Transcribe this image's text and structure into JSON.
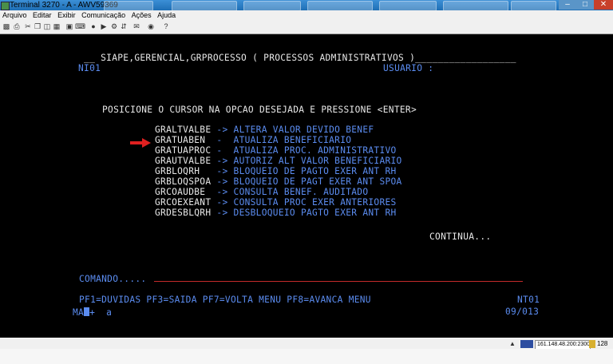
{
  "window": {
    "title": "Terminal 3270 - A - AWV59369"
  },
  "menu": {
    "arquivo": "Arquivo",
    "editar": "Editar",
    "exibir": "Exibir",
    "comunicacao": "Comunicação",
    "acoes": "Ações",
    "ajuda": "Ajuda"
  },
  "screen": {
    "header": " __ SIAPE,GERENCIAL,GRPROCESSO ( PROCESSOS ADMINISTRATIVOS )__________________",
    "terminal_id": "NI01",
    "usuario_label": "USUARIO :",
    "instruction": "POSICIONE O CURSOR NA OPCAO DESEJADA E PRESSIONE <ENTER>",
    "options": [
      {
        "code": "GRALTVALBE",
        "sep": "->",
        "desc": "ALTERA VALOR DEVIDO BENEF"
      },
      {
        "code": "GRATUABEN",
        "sep": "- ",
        "desc": "ATUALIZA BENEFICIARIO"
      },
      {
        "code": "GRATUAPROC",
        "sep": "- ",
        "desc": "ATUALIZA PROC. ADMINISTRATIVO"
      },
      {
        "code": "GRAUTVALBE",
        "sep": "->",
        "desc": "AUTORIZ ALT VALOR BENEFICIARIO"
      },
      {
        "code": "GRBLOQRH",
        "sep": "->",
        "desc": "BLOQUEIO DE PAGTO EXER ANT RH"
      },
      {
        "code": "GRBLOQSPOA",
        "sep": "->",
        "desc": "BLOQUEIO DE PAGT EXER ANT SPOA"
      },
      {
        "code": "GRCOAUDBE",
        "sep": "->",
        "desc": "CONSULTA BENEF. AUDITADO"
      },
      {
        "code": "GRCOEXEANT",
        "sep": "->",
        "desc": "CONSULTA PROC EXER ANTERIORES"
      },
      {
        "code": "GRDESBLQRH",
        "sep": "->",
        "desc": "DESBLOQUEIO PAGTO EXER ANT RH"
      }
    ],
    "continua": "CONTINUA...",
    "comando_label": "COMANDO.....",
    "pf_keys": "PF1=DUVIDAS PF3=SAIDA PF7=VOLTA MENU PF8=AVANCA MENU",
    "screen_code": "NT01",
    "oia_left_a": "MA",
    "oia_left_b": "+  a",
    "oia_right": "09/013"
  },
  "status": {
    "host": "161.148.48.200:23000",
    "count": "128"
  },
  "colors": {
    "terminal_bg": "#000000",
    "field_text": "#5b8cf0",
    "highlight_text": "#e8e8e8",
    "arrow": "#e02020",
    "command_underline": "#c42b2b"
  }
}
